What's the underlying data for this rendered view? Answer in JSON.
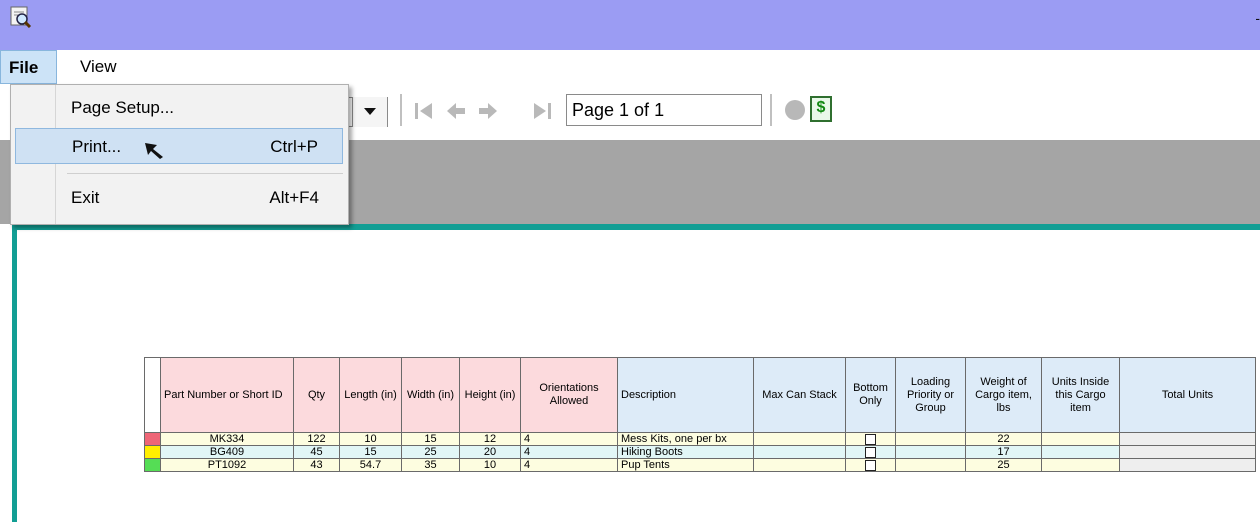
{
  "window": {
    "title_dash": "-"
  },
  "menubar": {
    "file": "File",
    "view": "View"
  },
  "toolbar": {
    "page_field": "Page 1 of 1"
  },
  "file_menu": {
    "items": [
      {
        "label": "Page Setup...",
        "shortcut": ""
      },
      {
        "label": "Print...",
        "shortcut": "Ctrl+P"
      },
      {
        "label": "Exit",
        "shortcut": "Alt+F4"
      }
    ]
  },
  "table": {
    "headers": {
      "part": "Part Number or Short ID",
      "qty": "Qty",
      "length": "Length (in)",
      "width": "Width (in)",
      "height": "Height (in)",
      "orient": "Orientations Allowed",
      "desc": "Description",
      "maxstack": "Max Can Stack",
      "bottom": "Bottom Only",
      "priority": "Loading Priority or Group",
      "weight": "Weight of Cargo item, lbs",
      "units": "Units Inside this Cargo item",
      "total": "Total Units"
    },
    "rows": [
      {
        "color": "#ee6677",
        "part": "MK334",
        "qty": "122",
        "length": "10",
        "width": "15",
        "height": "12",
        "orient": "4",
        "desc": "Mess Kits, one per bx",
        "maxstack": "",
        "bottom": "",
        "priority": "",
        "weight": "22",
        "units": "",
        "total": ""
      },
      {
        "color": "#ffee00",
        "part": "BG409",
        "qty": "45",
        "length": "15",
        "width": "25",
        "height": "20",
        "orient": "4",
        "desc": "Hiking Boots",
        "maxstack": "",
        "bottom": "",
        "priority": "",
        "weight": "17",
        "units": "",
        "total": ""
      },
      {
        "color": "#55dd55",
        "part": "PT1092",
        "qty": "43",
        "length": "54.7",
        "width": "35",
        "height": "10",
        "orient": "4",
        "desc": "Pup Tents",
        "maxstack": "",
        "bottom": "",
        "priority": "",
        "weight": "25",
        "units": "",
        "total": ""
      }
    ]
  },
  "icons": {
    "app": "magnifier-report-icon",
    "first": "first-page-icon",
    "prev": "previous-page-icon",
    "next": "next-page-icon",
    "last": "last-page-icon",
    "stop": "stop-icon",
    "refresh": "refresh-icon"
  }
}
